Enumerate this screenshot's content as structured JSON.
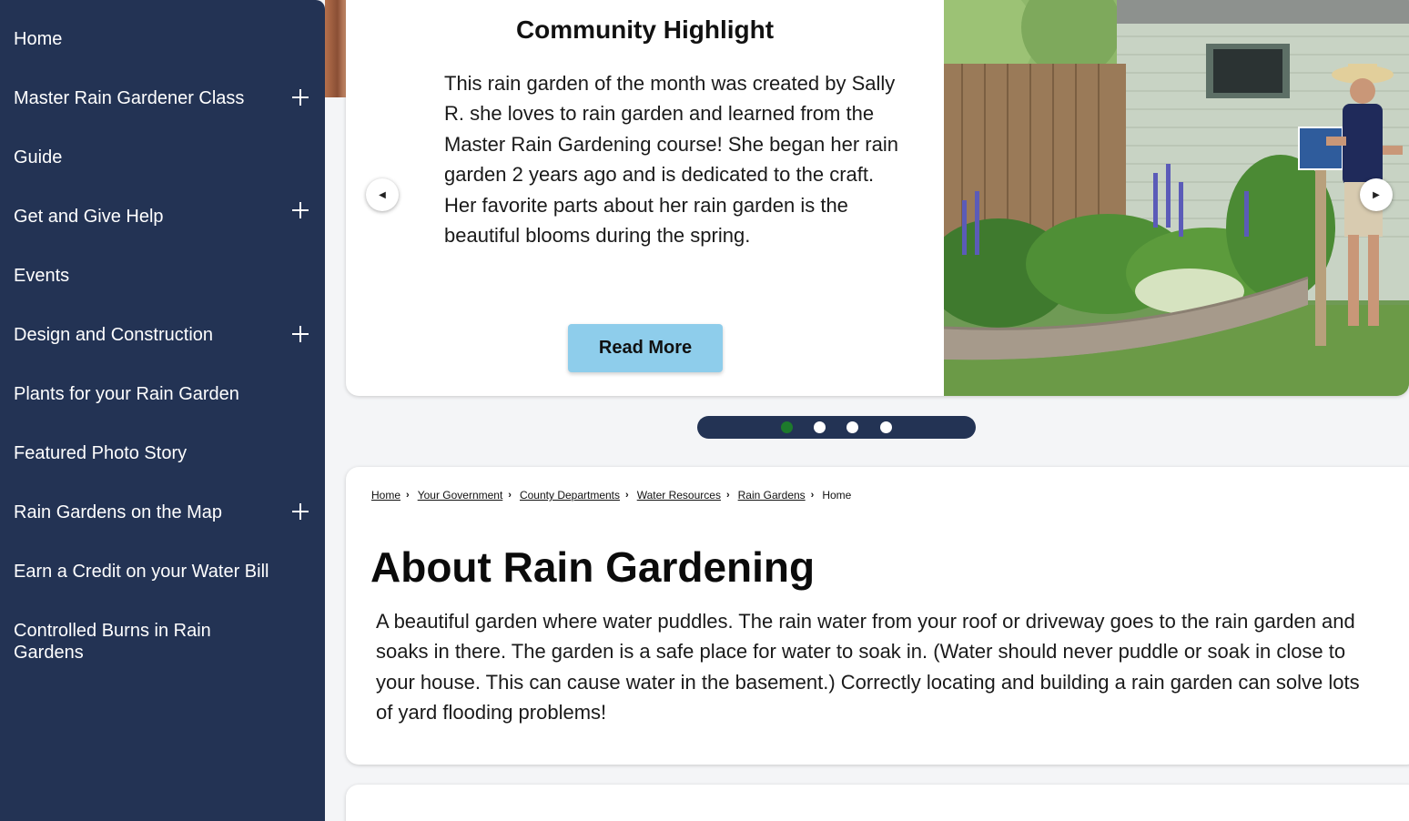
{
  "sidebar": {
    "items": [
      {
        "label": "Home",
        "expandable": false
      },
      {
        "label": "Master Rain Gardener Class",
        "expandable": true
      },
      {
        "label": "Guide",
        "expandable": false
      },
      {
        "label": "Get and Give Help",
        "expandable": true
      },
      {
        "label": "Events",
        "expandable": false
      },
      {
        "label": "Design and Construction",
        "expandable": true
      },
      {
        "label": "Plants for your Rain Garden",
        "expandable": false
      },
      {
        "label": "Featured Photo Story",
        "expandable": false
      },
      {
        "label": "Rain Gardens on the Map",
        "expandable": true
      },
      {
        "label": "Earn a Credit on your Water Bill",
        "expandable": false
      },
      {
        "label": "Controlled Burns in Rain Gardens",
        "expandable": false
      }
    ],
    "expand_icon": "plus-icon"
  },
  "carousel": {
    "title": "Community Highlight",
    "text": "This rain garden of the month was created by Sally R. she loves to rain garden and learned from the Master Rain Gardening course! She began her rain garden 2 years ago and is dedicated to the craft. Her favorite parts about her rain garden is the beautiful blooms during the spring.",
    "button_label": "Read More",
    "prev_icon": "◀",
    "next_icon": "▶",
    "slide_count": 4,
    "active_slide": 1
  },
  "breadcrumb": {
    "links": [
      "Home",
      "Your Government",
      "County Departments",
      "Water Resources",
      "Rain Gardens"
    ],
    "current": "Home",
    "separator": "›"
  },
  "main": {
    "title": "About Rain Gardening",
    "body": "A beautiful garden where water puddles. The rain water from your roof or driveway goes to the rain garden and soaks in there. The garden is a safe place for water to soak in. (Water should never puddle or soak in close to your house. This can cause water in the basement.) Correctly locating and building a rain garden can solve lots of yard flooding problems!"
  },
  "colors": {
    "sidebar_bg": "#233354",
    "button_bg": "#8ecdeb",
    "active_dot": "#1d7a2c"
  }
}
